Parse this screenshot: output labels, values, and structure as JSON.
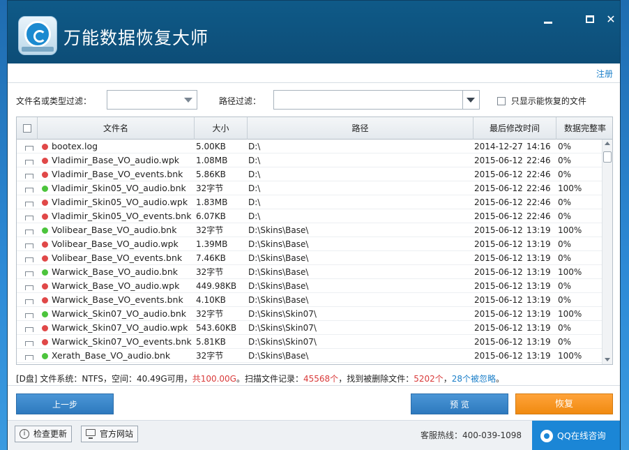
{
  "app": {
    "title": "万能数据恢复大师"
  },
  "window_controls": {
    "minimize": "minimize",
    "maximize": "maximize",
    "close": "✕"
  },
  "toolbar": {
    "register": "注册"
  },
  "filters": {
    "name_type_label": "文件名或类型过滤：",
    "name_type_value": "",
    "path_label": "路径过滤：",
    "path_value": "",
    "only_recoverable_label": "只显示能恢复的文件"
  },
  "table": {
    "columns": [
      "文件名",
      "大小",
      "路径",
      "最后修改时间",
      "数据完整率"
    ],
    "rows": [
      {
        "status": "red",
        "name": "bootex.log",
        "size": "5.00KB",
        "path": "D:\\",
        "date": "2014-12-27",
        "time": "14:16",
        "integrity": "0%"
      },
      {
        "status": "red",
        "name": "Vladimir_Base_VO_audio.wpk",
        "size": "1.08MB",
        "path": "D:\\",
        "date": "2015-06-12",
        "time": "22:46",
        "integrity": "0%"
      },
      {
        "status": "red",
        "name": "Vladimir_Base_VO_events.bnk",
        "size": "5.86KB",
        "path": "D:\\",
        "date": "2015-06-12",
        "time": "22:46",
        "integrity": "0%"
      },
      {
        "status": "green",
        "name": "Vladimir_Skin05_VO_audio.bnk",
        "size": "32字节",
        "path": "D:\\",
        "date": "2015-06-12",
        "time": "22:46",
        "integrity": "100%"
      },
      {
        "status": "red",
        "name": "Vladimir_Skin05_VO_audio.wpk",
        "size": "1.83MB",
        "path": "D:\\",
        "date": "2015-06-12",
        "time": "22:46",
        "integrity": "0%"
      },
      {
        "status": "red",
        "name": "Vladimir_Skin05_VO_events.bnk",
        "size": "6.07KB",
        "path": "D:\\",
        "date": "2015-06-12",
        "time": "22:46",
        "integrity": "0%"
      },
      {
        "status": "green",
        "name": "Volibear_Base_VO_audio.bnk",
        "size": "32字节",
        "path": "D:\\Skins\\Base\\",
        "date": "2015-06-12",
        "time": "13:19",
        "integrity": "100%"
      },
      {
        "status": "red",
        "name": "Volibear_Base_VO_audio.wpk",
        "size": "1.39MB",
        "path": "D:\\Skins\\Base\\",
        "date": "2015-06-12",
        "time": "13:19",
        "integrity": "0%"
      },
      {
        "status": "red",
        "name": "Volibear_Base_VO_events.bnk",
        "size": "7.46KB",
        "path": "D:\\Skins\\Base\\",
        "date": "2015-06-12",
        "time": "13:19",
        "integrity": "0%"
      },
      {
        "status": "green",
        "name": "Warwick_Base_VO_audio.bnk",
        "size": "32字节",
        "path": "D:\\Skins\\Base\\",
        "date": "2015-06-12",
        "time": "13:19",
        "integrity": "100%"
      },
      {
        "status": "red",
        "name": "Warwick_Base_VO_audio.wpk",
        "size": "449.98KB",
        "path": "D:\\Skins\\Base\\",
        "date": "2015-06-12",
        "time": "13:19",
        "integrity": "0%"
      },
      {
        "status": "red",
        "name": "Warwick_Base_VO_events.bnk",
        "size": "4.10KB",
        "path": "D:\\Skins\\Base\\",
        "date": "2015-06-12",
        "time": "13:19",
        "integrity": "0%"
      },
      {
        "status": "green",
        "name": "Warwick_Skin07_VO_audio.bnk",
        "size": "32字节",
        "path": "D:\\Skins\\Skin07\\",
        "date": "2015-06-12",
        "time": "13:19",
        "integrity": "100%"
      },
      {
        "status": "red",
        "name": "Warwick_Skin07_VO_audio.wpk",
        "size": "543.60KB",
        "path": "D:\\Skins\\Skin07\\",
        "date": "2015-06-12",
        "time": "13:19",
        "integrity": "0%"
      },
      {
        "status": "red",
        "name": "Warwick_Skin07_VO_events.bnk",
        "size": "5.81KB",
        "path": "D:\\Skins\\Skin07\\",
        "date": "2015-06-12",
        "time": "13:19",
        "integrity": "0%"
      },
      {
        "status": "green",
        "name": "Xerath_Base_VO_audio.bnk",
        "size": "32字节",
        "path": "D:\\Skins\\Base\\",
        "date": "2015-06-12",
        "time": "13:19",
        "integrity": "100%"
      }
    ]
  },
  "status": {
    "part1": "[D盘] 文件系统：NTFS，空间：40.49G可用，",
    "total": "共100.00G",
    "part2": "。扫描文件记录：",
    "records": "45568个",
    "part3": "，找到被删除文件：",
    "deleted": "5202个",
    "part4": "，",
    "ignored": "28个被忽略",
    "part5": "。"
  },
  "actions": {
    "back": "上一步",
    "preview": "预 览",
    "recover": "恢复"
  },
  "footer": {
    "check_update": "检查更新",
    "official_site": "官方网站",
    "hotline": "客服热线：400-039-1098",
    "qq_support": "QQ在线咨询"
  },
  "colors": {
    "title_bar": "#0f5a88",
    "accent_blue": "#2d79be",
    "accent_orange": "#f08a10",
    "status_red": "#d93a3a",
    "status_green": "#4cc43c"
  }
}
